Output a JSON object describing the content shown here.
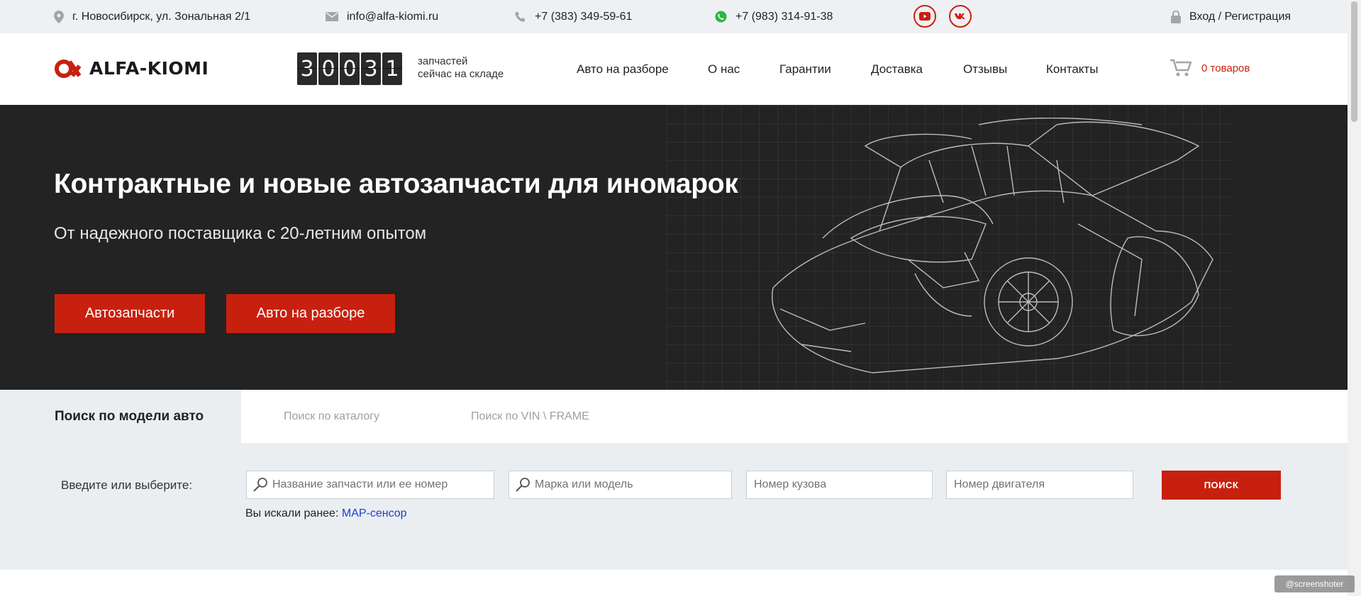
{
  "topbar": {
    "address": "г. Новосибирск, ул. Зональная 2/1",
    "email": "info@alfa-kiomi.ru",
    "phone": "+7 (383) 349-59-61",
    "whatsapp": "+7 (983) 314-91-38",
    "login": "Вход / Регистрация"
  },
  "header": {
    "logo_text": "ALFA-KIOMI",
    "counter_digits": [
      "3",
      "0",
      "0",
      "3",
      "1"
    ],
    "counter_line1": "запчастей",
    "counter_line2": "сейчас на складе",
    "nav": [
      "Авто на разборе",
      "О нас",
      "Гарантии",
      "Доставка",
      "Отзывы",
      "Контакты"
    ],
    "cart_label": "0 товаров"
  },
  "hero": {
    "title": "Контрактные и новые автозапчасти для иномарок",
    "subtitle": "От надежного поставщика с 20-летним опытом",
    "btn_parts": "Автозапчасти",
    "btn_cars": "Авто на разборе"
  },
  "search": {
    "tabs": [
      "Поиск по модели авто",
      "Поиск по каталогу",
      "Поиск по VIN \\ FRAME"
    ],
    "label": "Введите или выберите:",
    "placeholder_part": "Название запчасти или ее номер",
    "placeholder_model": "Марка или модель",
    "placeholder_body": "Номер кузова",
    "placeholder_engine": "Номер двигателя",
    "button": "ПОИСК",
    "recent_prefix": "Вы искали ранее:",
    "recent_link": "МАР-сенсор"
  },
  "watermark": "@screenshoter",
  "colors": {
    "accent": "#c8200f",
    "hero_bg": "#232323",
    "topbar_bg": "#eef0f3"
  }
}
